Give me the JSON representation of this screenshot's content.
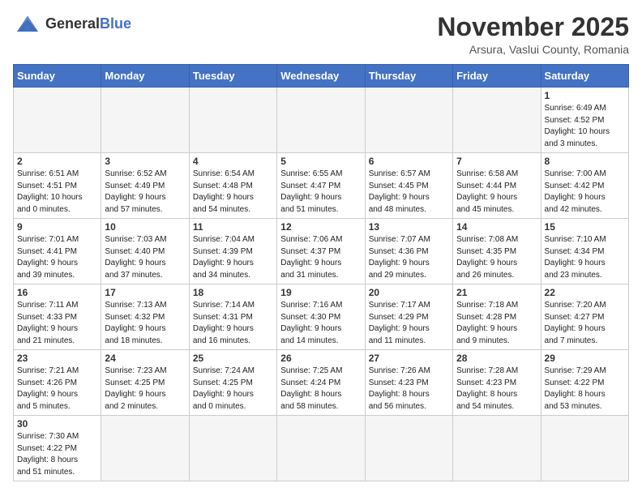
{
  "header": {
    "logo_text_normal": "General",
    "logo_text_bold": "Blue",
    "month_title": "November 2025",
    "subtitle": "Arsura, Vaslui County, Romania"
  },
  "days_of_week": [
    "Sunday",
    "Monday",
    "Tuesday",
    "Wednesday",
    "Thursday",
    "Friday",
    "Saturday"
  ],
  "weeks": [
    [
      {
        "day": "",
        "info": ""
      },
      {
        "day": "",
        "info": ""
      },
      {
        "day": "",
        "info": ""
      },
      {
        "day": "",
        "info": ""
      },
      {
        "day": "",
        "info": ""
      },
      {
        "day": "",
        "info": ""
      },
      {
        "day": "1",
        "info": "Sunrise: 6:49 AM\nSunset: 4:52 PM\nDaylight: 10 hours\nand 3 minutes."
      }
    ],
    [
      {
        "day": "2",
        "info": "Sunrise: 6:51 AM\nSunset: 4:51 PM\nDaylight: 10 hours\nand 0 minutes."
      },
      {
        "day": "3",
        "info": "Sunrise: 6:52 AM\nSunset: 4:49 PM\nDaylight: 9 hours\nand 57 minutes."
      },
      {
        "day": "4",
        "info": "Sunrise: 6:54 AM\nSunset: 4:48 PM\nDaylight: 9 hours\nand 54 minutes."
      },
      {
        "day": "5",
        "info": "Sunrise: 6:55 AM\nSunset: 4:47 PM\nDaylight: 9 hours\nand 51 minutes."
      },
      {
        "day": "6",
        "info": "Sunrise: 6:57 AM\nSunset: 4:45 PM\nDaylight: 9 hours\nand 48 minutes."
      },
      {
        "day": "7",
        "info": "Sunrise: 6:58 AM\nSunset: 4:44 PM\nDaylight: 9 hours\nand 45 minutes."
      },
      {
        "day": "8",
        "info": "Sunrise: 7:00 AM\nSunset: 4:42 PM\nDaylight: 9 hours\nand 42 minutes."
      }
    ],
    [
      {
        "day": "9",
        "info": "Sunrise: 7:01 AM\nSunset: 4:41 PM\nDaylight: 9 hours\nand 39 minutes."
      },
      {
        "day": "10",
        "info": "Sunrise: 7:03 AM\nSunset: 4:40 PM\nDaylight: 9 hours\nand 37 minutes."
      },
      {
        "day": "11",
        "info": "Sunrise: 7:04 AM\nSunset: 4:39 PM\nDaylight: 9 hours\nand 34 minutes."
      },
      {
        "day": "12",
        "info": "Sunrise: 7:06 AM\nSunset: 4:37 PM\nDaylight: 9 hours\nand 31 minutes."
      },
      {
        "day": "13",
        "info": "Sunrise: 7:07 AM\nSunset: 4:36 PM\nDaylight: 9 hours\nand 29 minutes."
      },
      {
        "day": "14",
        "info": "Sunrise: 7:08 AM\nSunset: 4:35 PM\nDaylight: 9 hours\nand 26 minutes."
      },
      {
        "day": "15",
        "info": "Sunrise: 7:10 AM\nSunset: 4:34 PM\nDaylight: 9 hours\nand 23 minutes."
      }
    ],
    [
      {
        "day": "16",
        "info": "Sunrise: 7:11 AM\nSunset: 4:33 PM\nDaylight: 9 hours\nand 21 minutes."
      },
      {
        "day": "17",
        "info": "Sunrise: 7:13 AM\nSunset: 4:32 PM\nDaylight: 9 hours\nand 18 minutes."
      },
      {
        "day": "18",
        "info": "Sunrise: 7:14 AM\nSunset: 4:31 PM\nDaylight: 9 hours\nand 16 minutes."
      },
      {
        "day": "19",
        "info": "Sunrise: 7:16 AM\nSunset: 4:30 PM\nDaylight: 9 hours\nand 14 minutes."
      },
      {
        "day": "20",
        "info": "Sunrise: 7:17 AM\nSunset: 4:29 PM\nDaylight: 9 hours\nand 11 minutes."
      },
      {
        "day": "21",
        "info": "Sunrise: 7:18 AM\nSunset: 4:28 PM\nDaylight: 9 hours\nand 9 minutes."
      },
      {
        "day": "22",
        "info": "Sunrise: 7:20 AM\nSunset: 4:27 PM\nDaylight: 9 hours\nand 7 minutes."
      }
    ],
    [
      {
        "day": "23",
        "info": "Sunrise: 7:21 AM\nSunset: 4:26 PM\nDaylight: 9 hours\nand 5 minutes."
      },
      {
        "day": "24",
        "info": "Sunrise: 7:23 AM\nSunset: 4:25 PM\nDaylight: 9 hours\nand 2 minutes."
      },
      {
        "day": "25",
        "info": "Sunrise: 7:24 AM\nSunset: 4:25 PM\nDaylight: 9 hours\nand 0 minutes."
      },
      {
        "day": "26",
        "info": "Sunrise: 7:25 AM\nSunset: 4:24 PM\nDaylight: 8 hours\nand 58 minutes."
      },
      {
        "day": "27",
        "info": "Sunrise: 7:26 AM\nSunset: 4:23 PM\nDaylight: 8 hours\nand 56 minutes."
      },
      {
        "day": "28",
        "info": "Sunrise: 7:28 AM\nSunset: 4:23 PM\nDaylight: 8 hours\nand 54 minutes."
      },
      {
        "day": "29",
        "info": "Sunrise: 7:29 AM\nSunset: 4:22 PM\nDaylight: 8 hours\nand 53 minutes."
      }
    ],
    [
      {
        "day": "30",
        "info": "Sunrise: 7:30 AM\nSunset: 4:22 PM\nDaylight: 8 hours\nand 51 minutes."
      },
      {
        "day": "",
        "info": ""
      },
      {
        "day": "",
        "info": ""
      },
      {
        "day": "",
        "info": ""
      },
      {
        "day": "",
        "info": ""
      },
      {
        "day": "",
        "info": ""
      },
      {
        "day": "",
        "info": ""
      }
    ]
  ]
}
